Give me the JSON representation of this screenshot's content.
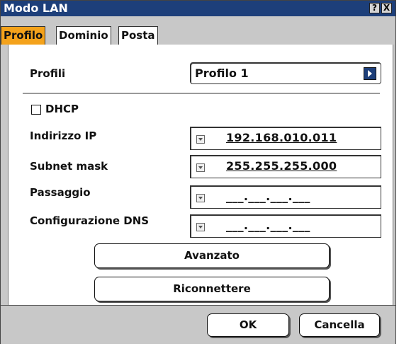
{
  "window": {
    "title": "Modo LAN",
    "help_label": "?",
    "close_label": "X"
  },
  "tabs": [
    {
      "label": "Profilo",
      "active": true
    },
    {
      "label": "Dominio",
      "active": false
    },
    {
      "label": "Posta",
      "active": false
    }
  ],
  "profile": {
    "label": "Profili",
    "value": "Profilo 1"
  },
  "dhcp": {
    "label": "DHCP",
    "checked": false
  },
  "ip": {
    "label": "Indirizzo IP",
    "value": "192.168.010.011"
  },
  "subnet": {
    "label": "Subnet mask",
    "value": "255.255.255.000"
  },
  "gateway": {
    "label": "Passaggio",
    "value": "___.___.___.___"
  },
  "dns": {
    "label": "Configurazione DNS",
    "value": "___.___.___.___"
  },
  "buttons": {
    "advanced": "Avanzato",
    "reconnect": "Riconnettere",
    "ok": "OK",
    "cancel": "Cancella"
  },
  "colors": {
    "titlebar": "#1d3f7a",
    "active_tab": "#f4a21b",
    "window_bg": "#c8c8c8"
  }
}
